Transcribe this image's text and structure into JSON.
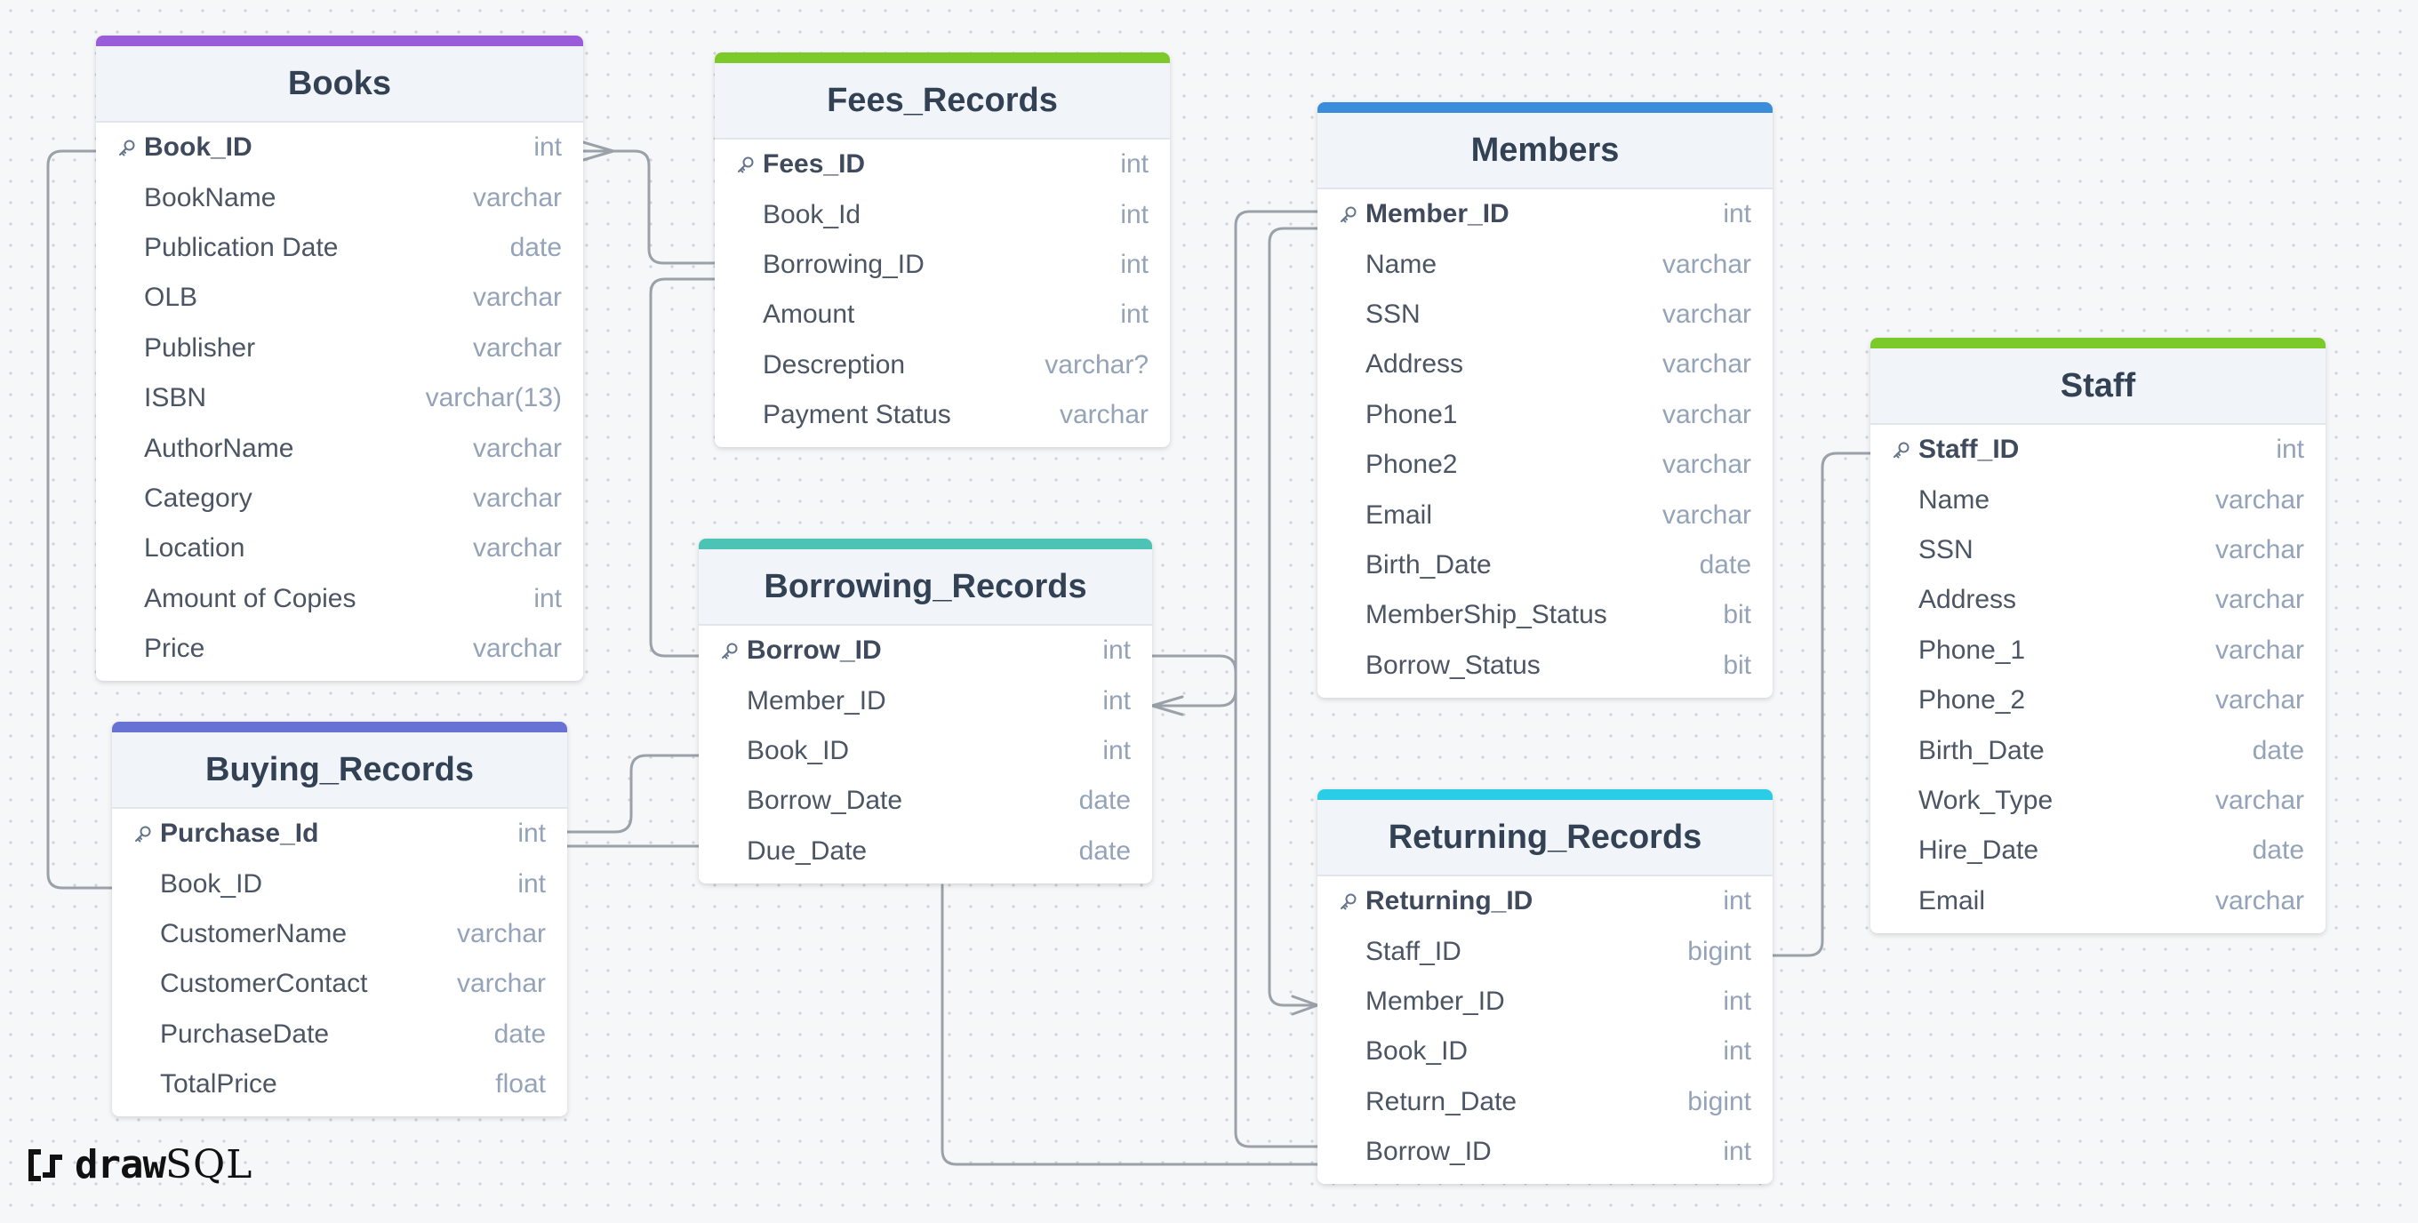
{
  "app": {
    "brand_draw": "draw",
    "brand_sql": "SQL"
  },
  "tables": {
    "books": {
      "title": "Books",
      "accent": "#9a5cd9",
      "columns": [
        {
          "name": "Book_ID",
          "type": "int",
          "pk": true
        },
        {
          "name": "BookName",
          "type": "varchar"
        },
        {
          "name": "Publication Date",
          "type": "date"
        },
        {
          "name": "OLB",
          "type": "varchar"
        },
        {
          "name": "Publisher",
          "type": "varchar"
        },
        {
          "name": "ISBN",
          "type": "varchar(13)"
        },
        {
          "name": "AuthorName",
          "type": "varchar"
        },
        {
          "name": "Category",
          "type": "varchar"
        },
        {
          "name": "Location",
          "type": "varchar"
        },
        {
          "name": "Amount of Copies",
          "type": "int"
        },
        {
          "name": "Price",
          "type": "varchar"
        }
      ]
    },
    "fees": {
      "title": "Fees_Records",
      "accent": "#7cc92a",
      "columns": [
        {
          "name": "Fees_ID",
          "type": "int",
          "pk": true
        },
        {
          "name": "Book_Id",
          "type": "int"
        },
        {
          "name": "Borrowing_ID",
          "type": "int"
        },
        {
          "name": "Amount",
          "type": "int"
        },
        {
          "name": "Descreption",
          "type": "varchar?"
        },
        {
          "name": "Payment Status",
          "type": "varchar"
        }
      ]
    },
    "members": {
      "title": "Members",
      "accent": "#3a8ddb",
      "columns": [
        {
          "name": "Member_ID",
          "type": "int",
          "pk": true
        },
        {
          "name": "Name",
          "type": "varchar"
        },
        {
          "name": "SSN",
          "type": "varchar"
        },
        {
          "name": "Address",
          "type": "varchar"
        },
        {
          "name": "Phone1",
          "type": "varchar"
        },
        {
          "name": "Phone2",
          "type": "varchar"
        },
        {
          "name": "Email",
          "type": "varchar"
        },
        {
          "name": "Birth_Date",
          "type": "date"
        },
        {
          "name": "MemberShip_Status",
          "type": "bit"
        },
        {
          "name": "Borrow_Status",
          "type": "bit"
        }
      ]
    },
    "staff": {
      "title": "Staff",
      "accent": "#7cc92a",
      "columns": [
        {
          "name": "Staff_ID",
          "type": "int",
          "pk": true
        },
        {
          "name": "Name",
          "type": "varchar"
        },
        {
          "name": "SSN",
          "type": "varchar"
        },
        {
          "name": "Address",
          "type": "varchar"
        },
        {
          "name": "Phone_1",
          "type": "varchar"
        },
        {
          "name": "Phone_2",
          "type": "varchar"
        },
        {
          "name": "Birth_Date",
          "type": "date"
        },
        {
          "name": "Work_Type",
          "type": "varchar"
        },
        {
          "name": "Hire_Date",
          "type": "date"
        },
        {
          "name": "Email",
          "type": "varchar"
        }
      ]
    },
    "borrowing": {
      "title": "Borrowing_Records",
      "accent": "#4cc3b4",
      "columns": [
        {
          "name": "Borrow_ID",
          "type": "int",
          "pk": true
        },
        {
          "name": "Member_ID",
          "type": "int"
        },
        {
          "name": "Book_ID",
          "type": "int"
        },
        {
          "name": "Borrow_Date",
          "type": "date"
        },
        {
          "name": "Due_Date",
          "type": "date"
        }
      ]
    },
    "buying": {
      "title": "Buying_Records",
      "accent": "#6872d4",
      "columns": [
        {
          "name": "Purchase_Id",
          "type": "int",
          "pk": true
        },
        {
          "name": "Book_ID",
          "type": "int"
        },
        {
          "name": "CustomerName",
          "type": "varchar"
        },
        {
          "name": "CustomerContact",
          "type": "varchar"
        },
        {
          "name": "PurchaseDate",
          "type": "date"
        },
        {
          "name": "TotalPrice",
          "type": "float"
        }
      ]
    },
    "returning": {
      "title": "Returning_Records",
      "accent": "#2bcde6",
      "columns": [
        {
          "name": "Returning_ID",
          "type": "int",
          "pk": true
        },
        {
          "name": "Staff_ID",
          "type": "bigint"
        },
        {
          "name": "Member_ID",
          "type": "int"
        },
        {
          "name": "Book_ID",
          "type": "int"
        },
        {
          "name": "Return_Date",
          "type": "bigint"
        },
        {
          "name": "Borrow_ID",
          "type": "int"
        }
      ]
    }
  }
}
